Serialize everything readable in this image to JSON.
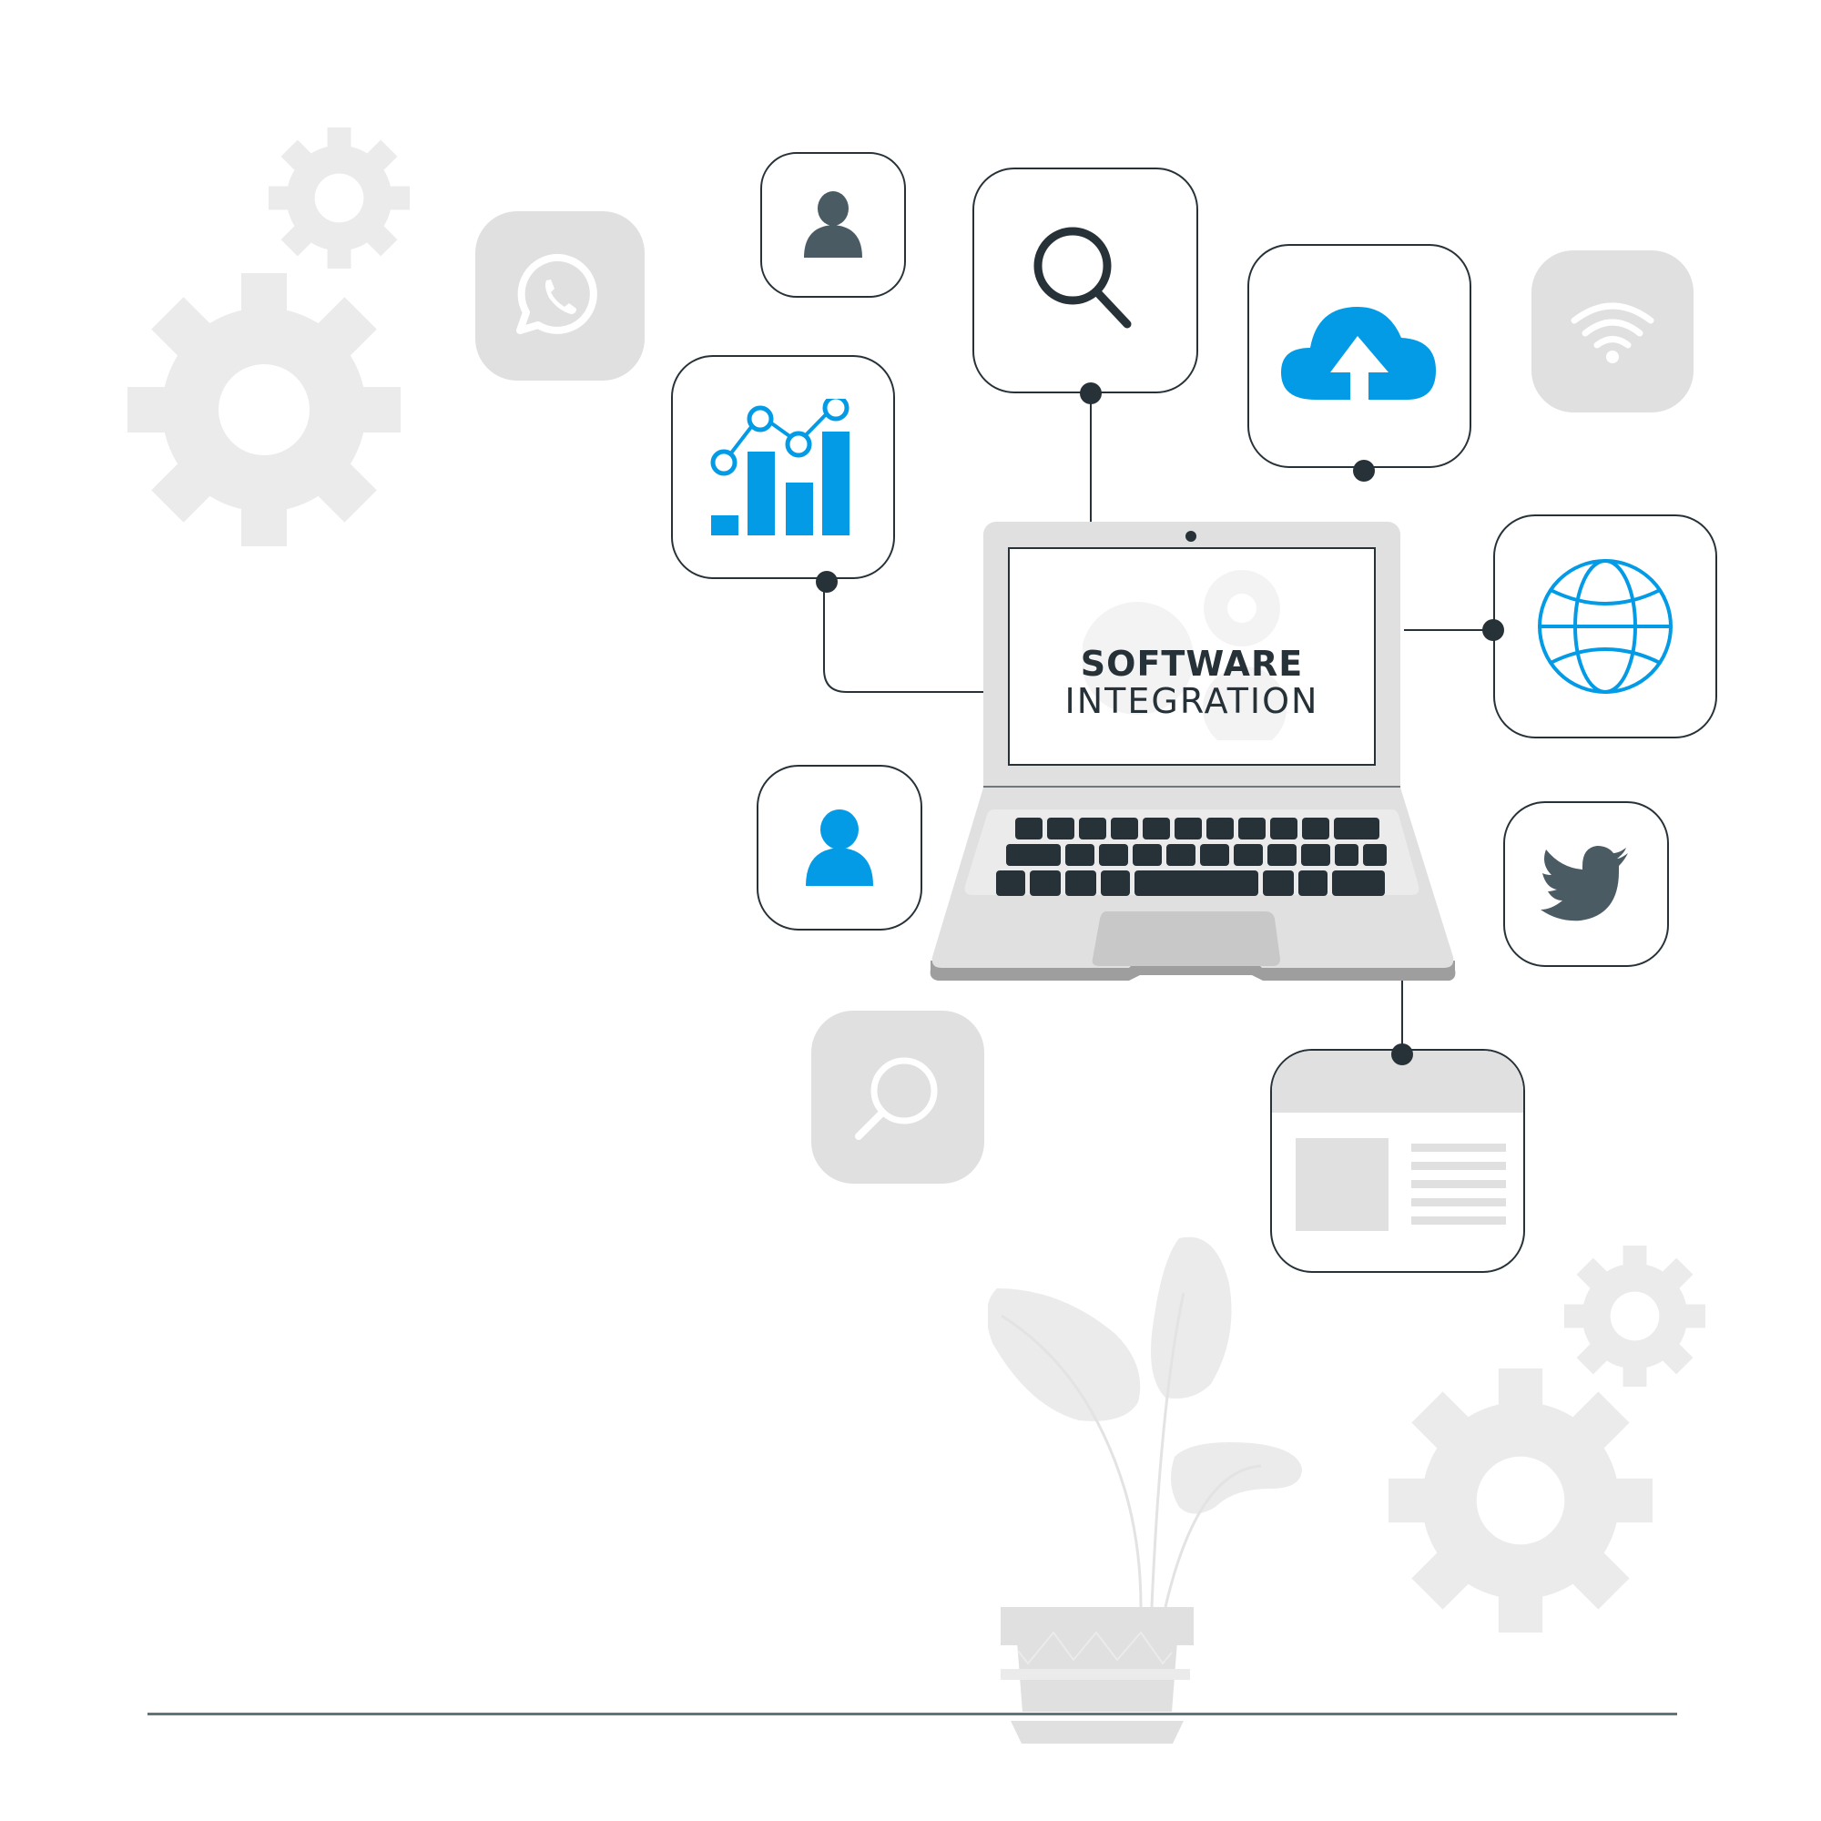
{
  "illustration": {
    "title": "Software Integration",
    "screen_text": {
      "line1": "SOFTWARE",
      "line2": "INTEGRATION"
    }
  },
  "cards": [
    {
      "name": "user-card",
      "icon": "user-icon",
      "style": "outlined"
    },
    {
      "name": "search-card",
      "icon": "search-icon",
      "style": "outlined"
    },
    {
      "name": "cloud-upload-card",
      "icon": "cloud-upload-icon",
      "style": "outlined"
    },
    {
      "name": "analytics-card",
      "icon": "bar-line-chart-icon",
      "style": "outlined"
    },
    {
      "name": "globe-card",
      "icon": "globe-icon",
      "style": "outlined"
    },
    {
      "name": "contact-card",
      "icon": "user-icon",
      "style": "outlined"
    },
    {
      "name": "twitter-card",
      "icon": "twitter-bird-icon",
      "style": "outlined"
    },
    {
      "name": "webpage-card",
      "icon": "webpage-layout-icon",
      "style": "outlined"
    },
    {
      "name": "whatsapp-card",
      "icon": "whatsapp-icon",
      "style": "ghost"
    },
    {
      "name": "wifi-card",
      "icon": "wifi-icon",
      "style": "ghost"
    },
    {
      "name": "ghost-search-card",
      "icon": "search-icon",
      "style": "ghost"
    }
  ],
  "colors": {
    "accent": "#039BE5",
    "dark": "#263238",
    "slate": "#4B5B63",
    "ghost": "#E0E0E0",
    "gear": "#EBEBEB",
    "laptop_body": "#E0E0E0",
    "laptop_shadow": "#9E9E9E"
  }
}
